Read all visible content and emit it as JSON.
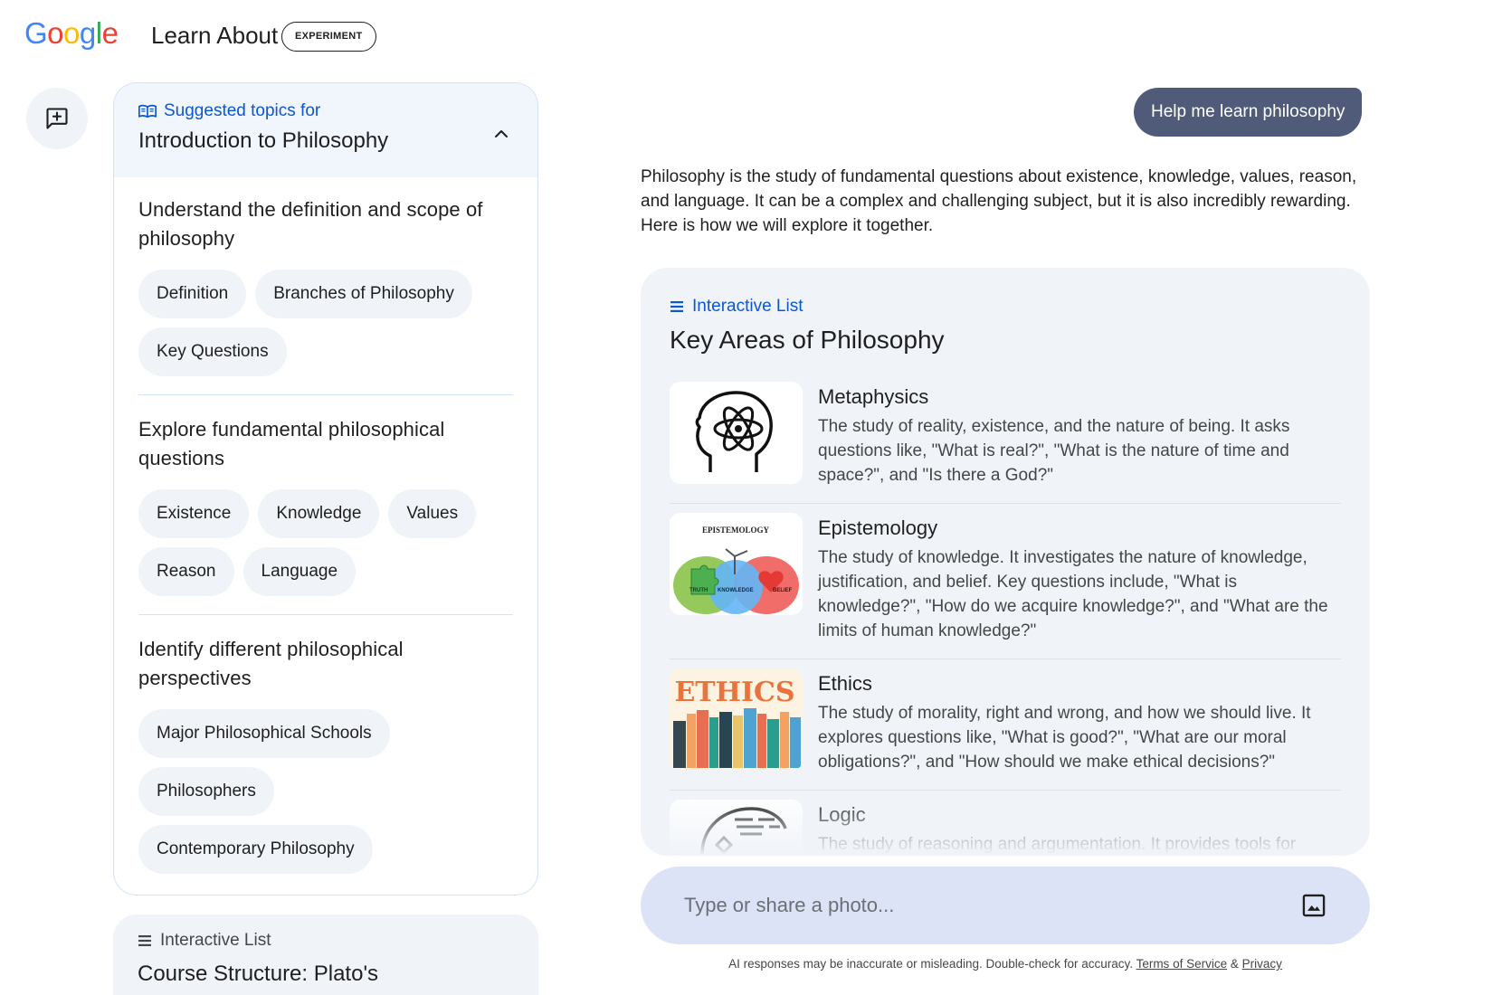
{
  "header": {
    "logo": [
      "G",
      "o",
      "o",
      "g",
      "l",
      "e"
    ],
    "app_title": "Learn About",
    "badge": "EXPERIMENT"
  },
  "sidebar": {
    "new_chat_icon": "new-chat-icon"
  },
  "topics": {
    "eyebrow": "Suggested topics for",
    "title": "Introduction to Philosophy",
    "sections": [
      {
        "heading": "Understand the definition and scope of philosophy",
        "chips": [
          "Definition",
          "Branches of Philosophy",
          "Key Questions"
        ]
      },
      {
        "heading": "Explore fundamental philosophical questions",
        "chips": [
          "Existence",
          "Knowledge",
          "Values",
          "Reason",
          "Language"
        ]
      },
      {
        "heading": "Identify different philosophical perspectives",
        "chips": [
          "Major Philosophical Schools",
          "Philosophers",
          "Contemporary Philosophy"
        ]
      }
    ]
  },
  "course": {
    "eyebrow": "Interactive List",
    "title": "Course Structure: Plato's"
  },
  "chat": {
    "user_message": "Help me learn philosophy",
    "intro": "Philosophy is the study of fundamental questions about existence, knowledge, values, reason, and language. It can be a complex and challenging subject, but it is also incredibly rewarding. Here is how we will explore it together.",
    "list": {
      "eyebrow": "Interactive List",
      "title": "Key Areas of Philosophy",
      "items": [
        {
          "name": "Metaphysics",
          "desc": "The study of reality, existence, and the nature of being. It asks questions like, \"What is real?\", \"What is the nature of time and space?\", and \"Is there a God?\""
        },
        {
          "name": "Epistemology",
          "desc": "The study of knowledge. It investigates the nature of knowledge, justification, and belief. Key questions include, \"What is knowledge?\", \"How do we acquire knowledge?\", and \"What are the limits of human knowledge?\"",
          "thumb_labels": [
            "EPISTEMOLOGY",
            "TRUTH",
            "KNOWLEDGE",
            "BELIEF"
          ]
        },
        {
          "name": "Ethics",
          "desc": "The study of morality, right and wrong, and how we should live. It explores questions like, \"What is good?\", \"What are our moral obligations?\", and \"How should we make ethical decisions?\"",
          "thumb_word": "ETHICS"
        },
        {
          "name": "Logic",
          "desc": "The study of reasoning and argumentation. It provides tools for"
        }
      ]
    }
  },
  "composer": {
    "placeholder": "Type or share a photo...",
    "photo_icon": "image-icon"
  },
  "disclaimer": {
    "text": "AI responses may be inaccurate or misleading. Double-check for accuracy.",
    "terms": "Terms of Service",
    "amp": "&",
    "privacy": "Privacy"
  },
  "colors": {
    "accent": "#0b57d0",
    "user_bubble": "#505b7a",
    "chip_bg": "#f0f4f9",
    "composer_bg": "#dde3f7"
  }
}
